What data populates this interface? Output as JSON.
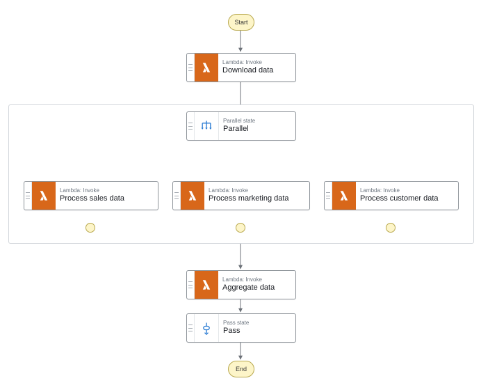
{
  "colors": {
    "lambda_icon_bg": "#d8671a",
    "terminator_fill": "#fdf5c9",
    "terminator_border": "#b8a84e",
    "arrow": "#6c7178"
  },
  "terminators": {
    "start": "Start",
    "end": "End"
  },
  "states": {
    "download": {
      "type": "Lambda: Invoke",
      "title": "Download data"
    },
    "parallel": {
      "type": "Parallel state",
      "title": "Parallel"
    },
    "sales": {
      "type": "Lambda: Invoke",
      "title": "Process sales data"
    },
    "marketing": {
      "type": "Lambda: Invoke",
      "title": "Process marketing data"
    },
    "customer": {
      "type": "Lambda: Invoke",
      "title": "Process customer data"
    },
    "aggregate": {
      "type": "Lambda: Invoke",
      "title": "Aggregate data"
    },
    "pass": {
      "type": "Pass state",
      "title": "Pass"
    }
  }
}
